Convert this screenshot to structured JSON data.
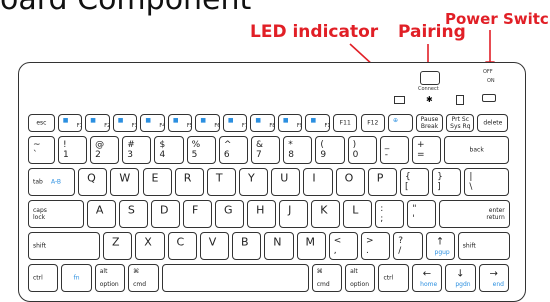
{
  "title": "oard Component",
  "annotations": {
    "led_indicator": "LED indicator",
    "pairing": "Pairing",
    "power_switch": "Power Switch"
  },
  "top_labels": {
    "connect": "Connect",
    "off": "OFF",
    "on": "ON"
  },
  "colors": {
    "annotation": "#e11f26",
    "fn_blue": "#2b8fe0",
    "outline": "#333333"
  },
  "rows": {
    "fn_row": [
      {
        "main": "esc"
      },
      {
        "main": "F1",
        "icon": "search-icon"
      },
      {
        "main": "F2",
        "icon": "window-icon"
      },
      {
        "main": "F3",
        "icon": "menu-icon"
      },
      {
        "main": "F4",
        "icon": "rewind-icon"
      },
      {
        "main": "F5",
        "icon": "play-pause-icon"
      },
      {
        "main": "F6",
        "icon": "forward-icon"
      },
      {
        "main": "F7",
        "icon": "mute-icon"
      },
      {
        "main": "F8",
        "icon": "volume-down-icon"
      },
      {
        "main": "F9",
        "icon": "volume-up-icon"
      },
      {
        "main": "F10",
        "icon": "lock-icon"
      },
      {
        "main": "F11"
      },
      {
        "main": "F12"
      },
      {
        "main": "",
        "icon": "globe-icon"
      },
      {
        "main": "Pause\nBreak"
      },
      {
        "main": "Prt Sc\nSys Rq"
      },
      {
        "main": "delete"
      }
    ],
    "num_row": [
      {
        "top": "~",
        "bottom": "`"
      },
      {
        "top": "!",
        "bottom": "1"
      },
      {
        "top": "@",
        "bottom": "2"
      },
      {
        "top": "#",
        "bottom": "3"
      },
      {
        "top": "$",
        "bottom": "4"
      },
      {
        "top": "%",
        "bottom": "5"
      },
      {
        "top": "^",
        "bottom": "6"
      },
      {
        "top": "&",
        "bottom": "7"
      },
      {
        "top": "*",
        "bottom": "8"
      },
      {
        "top": "(",
        "bottom": "9"
      },
      {
        "top": ")",
        "bottom": "0"
      },
      {
        "top": "_",
        "bottom": "-"
      },
      {
        "top": "+",
        "bottom": "="
      },
      {
        "main": "back"
      }
    ],
    "q_row": [
      {
        "main": "tab",
        "sub": "A-B"
      },
      {
        "main": "Q"
      },
      {
        "main": "W"
      },
      {
        "main": "E"
      },
      {
        "main": "R"
      },
      {
        "main": "T"
      },
      {
        "main": "Y"
      },
      {
        "main": "U"
      },
      {
        "main": "I"
      },
      {
        "main": "O"
      },
      {
        "main": "P"
      },
      {
        "top": "{",
        "bottom": "["
      },
      {
        "top": "}",
        "bottom": "]"
      },
      {
        "top": "|",
        "bottom": "\\"
      }
    ],
    "a_row": [
      {
        "main": "caps\nlock"
      },
      {
        "main": "A"
      },
      {
        "main": "S"
      },
      {
        "main": "D"
      },
      {
        "main": "F"
      },
      {
        "main": "G"
      },
      {
        "main": "H"
      },
      {
        "main": "J"
      },
      {
        "main": "K"
      },
      {
        "main": "L"
      },
      {
        "top": ":",
        "bottom": ";"
      },
      {
        "top": "\"",
        "bottom": "'"
      },
      {
        "main": "enter\nreturn"
      }
    ],
    "z_row": [
      {
        "main": "shift"
      },
      {
        "main": "Z"
      },
      {
        "main": "X"
      },
      {
        "main": "C"
      },
      {
        "main": "V"
      },
      {
        "main": "B"
      },
      {
        "main": "N"
      },
      {
        "main": "M"
      },
      {
        "top": "<",
        "bottom": ","
      },
      {
        "top": ">",
        "bottom": "."
      },
      {
        "top": "?",
        "bottom": "/"
      },
      {
        "main": "↑",
        "sub": "pgup"
      },
      {
        "main": "shift"
      }
    ],
    "bottom_row": [
      {
        "main": "ctrl"
      },
      {
        "main": "fn"
      },
      {
        "top": "alt",
        "main": "option"
      },
      {
        "top": "⌘",
        "main": "cmd"
      },
      {
        "main": ""
      },
      {
        "top": "⌘",
        "main": "cmd"
      },
      {
        "top": "alt",
        "main": "option"
      },
      {
        "main": "ctrl"
      },
      {
        "main": "←",
        "sub": "home"
      },
      {
        "main": "↓",
        "sub": "pgdn"
      },
      {
        "main": "→",
        "sub": "end"
      }
    ]
  }
}
